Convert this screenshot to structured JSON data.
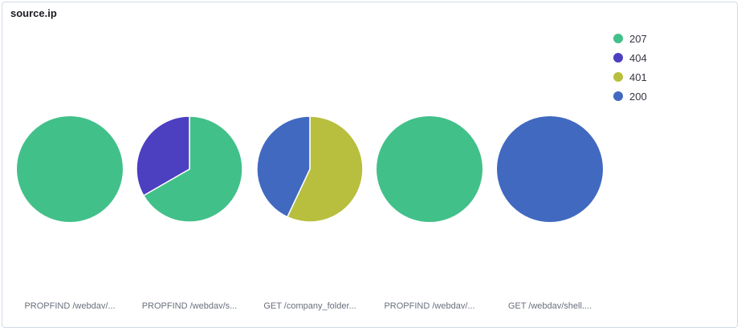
{
  "panel": {
    "title": "source.ip"
  },
  "chart_data": {
    "type": "pie",
    "legend_position": "top-right",
    "legend": [
      {
        "label": "207",
        "color": "#42c089"
      },
      {
        "label": "404",
        "color": "#4c3fc0"
      },
      {
        "label": "401",
        "color": "#b8bf3e"
      },
      {
        "label": "200",
        "color": "#4169c0"
      }
    ],
    "pies": [
      {
        "label": "PROPFIND /webdav/...",
        "slices": [
          {
            "key": "207",
            "value": 1
          }
        ]
      },
      {
        "label": "PROPFIND /webdav/s...",
        "slices": [
          {
            "key": "207",
            "value": 2
          },
          {
            "key": "404",
            "value": 1
          }
        ]
      },
      {
        "label": "GET /company_folder...",
        "slices": [
          {
            "key": "401",
            "value": 57
          },
          {
            "key": "200",
            "value": 43
          }
        ]
      },
      {
        "label": "PROPFIND /webdav/...",
        "slices": [
          {
            "key": "207",
            "value": 1
          }
        ]
      },
      {
        "label": "GET /webdav/shell....",
        "slices": [
          {
            "key": "200",
            "value": 1
          }
        ]
      }
    ]
  }
}
